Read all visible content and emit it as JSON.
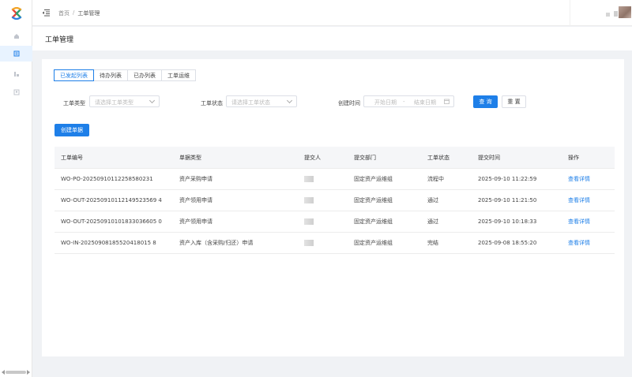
{
  "app": {
    "logo_icon": "brand-logo-icon",
    "nav": [
      {
        "icon": "home-icon",
        "active": false
      },
      {
        "icon": "ticket-icon",
        "active": true
      },
      {
        "icon": "chart-icon",
        "active": false
      },
      {
        "icon": "user-icon",
        "active": false
      }
    ]
  },
  "topbar": {
    "fold_icon": "menu-fold-icon",
    "breadcrumb": {
      "home": "首页",
      "separator": "/",
      "current": "工单管理"
    }
  },
  "page": {
    "title": "工单管理"
  },
  "tabs": [
    {
      "label": "已发起列表",
      "active": true
    },
    {
      "label": "待办列表",
      "active": false
    },
    {
      "label": "已办列表",
      "active": false
    },
    {
      "label": "工单运维",
      "active": false
    }
  ],
  "filters": {
    "type_label": "工单类型",
    "type_placeholder": "请选择工单类型",
    "status_label": "工单状态",
    "status_placeholder": "请选择工单状态",
    "time_label": "创建时间",
    "date_start_placeholder": "开始日期",
    "date_separator": "-",
    "date_end_placeholder": "结束日期",
    "search_button": "查 询",
    "reset_button": "重 置"
  },
  "create_button": "创建单据",
  "table": {
    "headers": [
      "工单编号",
      "单据类型",
      "提交人",
      "提交部门",
      "工单状态",
      "提交时间",
      "操作"
    ],
    "rows": [
      {
        "id": "WO-PO-20250910112258580231",
        "type": "资产采购申请",
        "dept": "固定资产运维组",
        "status": "流程中",
        "time": "2025-09-10 11:22:59",
        "action": "查看详情"
      },
      {
        "id": "WO-OUT-20250910112149523569 4",
        "type": "资产领用申请",
        "dept": "固定资产运维组",
        "status": "通过",
        "time": "2025-09-10 11:21:50",
        "action": "查看详情"
      },
      {
        "id": "WO-OUT-20250910101833036605 0",
        "type": "资产领用申请",
        "dept": "固定资产运维组",
        "status": "通过",
        "time": "2025-09-10 10:18:33",
        "action": "查看详情"
      },
      {
        "id": "WO-IN-20250908185520418015 8",
        "type": "资产入库（含采购/归还）申请",
        "dept": "固定资产运维组",
        "status": "完结",
        "time": "2025-09-08 18:55:20",
        "action": "查看详情"
      }
    ]
  },
  "colors": {
    "primary": "#1e7fe8",
    "background": "#f0f2f5",
    "nav_active_bg": "#e8f3ff"
  }
}
